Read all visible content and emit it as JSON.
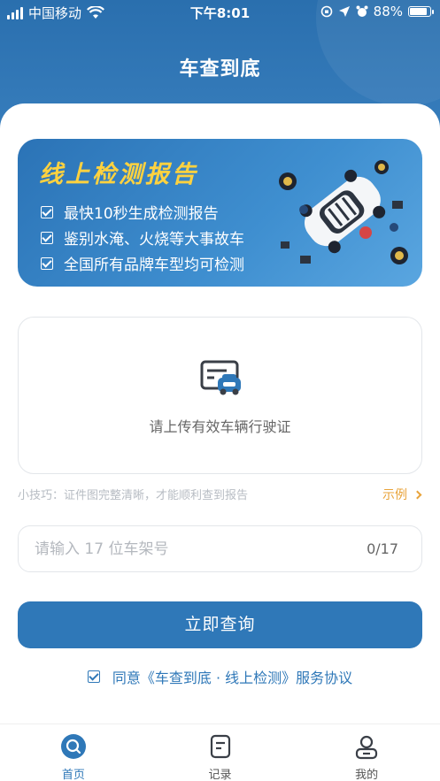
{
  "status_bar": {
    "carrier": "中国移动",
    "time": "下午8:01",
    "battery": "88%",
    "battery_level": 0.88
  },
  "app": {
    "title": "车查到底"
  },
  "banner": {
    "title": "线上检测报告",
    "items": [
      "最快10秒生成检测报告",
      "鉴别水淹、火烧等大事故车",
      "全国所有品牌车型均可检测"
    ]
  },
  "upload": {
    "text": "请上传有效车辆行驶证"
  },
  "tip": {
    "text": "小技巧：证件图完整清晰，才能顺利查到报告",
    "example_label": "示例"
  },
  "vin": {
    "placeholder": "请输入 17 位车架号",
    "value": "",
    "counter": "0/17"
  },
  "submit": {
    "label": "立即查询"
  },
  "agreement": {
    "text": "同意《车查到底 · 线上检测》服务协议"
  },
  "tabbar": {
    "items": [
      {
        "label": "首页",
        "icon": "home-search-icon",
        "active": true
      },
      {
        "label": "记录",
        "icon": "document-icon",
        "active": false
      },
      {
        "label": "我的",
        "icon": "person-icon",
        "active": false
      }
    ]
  },
  "colors": {
    "primary": "#2f78b8",
    "banner_title": "#ffd23f",
    "accent_orange": "#e8a33a"
  }
}
